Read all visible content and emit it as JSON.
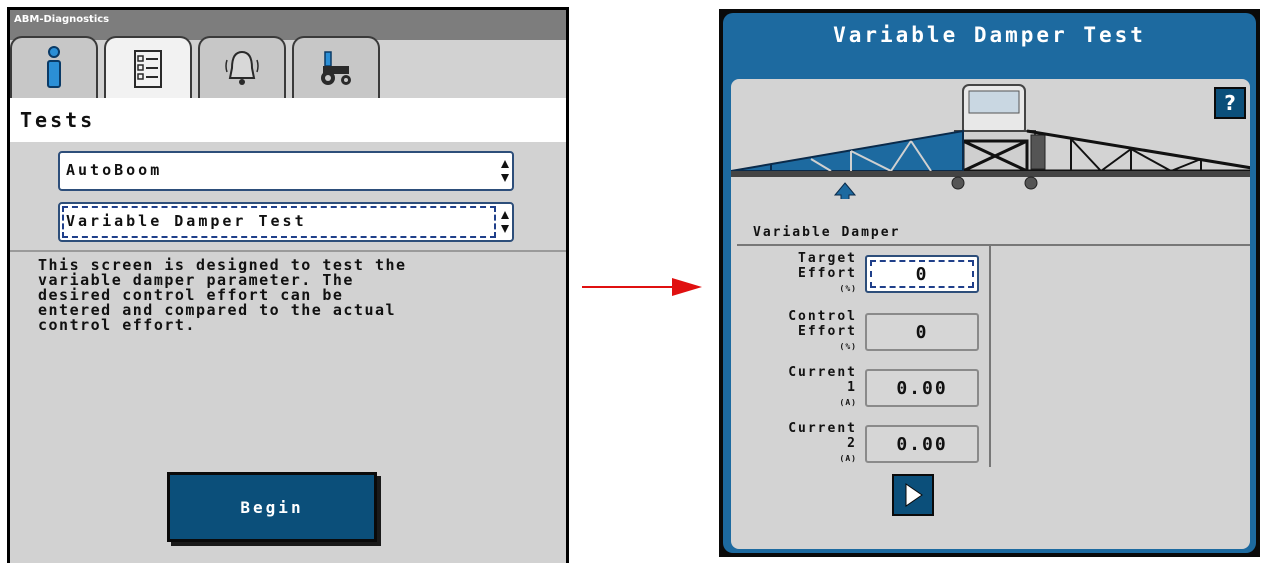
{
  "left": {
    "app_title": "ABM-Diagnostics",
    "tabs": [
      {
        "icon": "info-icon"
      },
      {
        "icon": "checklist-icon",
        "active": true
      },
      {
        "icon": "alarm-bell-icon"
      },
      {
        "icon": "tractor-icon"
      }
    ],
    "section_title": "Tests",
    "dropdown_system": {
      "value": "AutoBoom"
    },
    "dropdown_test": {
      "value": "Variable Damper Test"
    },
    "description": [
      "This screen is designed to test the",
      "variable damper parameter. The",
      "desired control effort can be",
      "entered and compared to the actual",
      "control effort."
    ],
    "begin_label": "Begin"
  },
  "right": {
    "title": "Variable Damper Test",
    "help_label": "?",
    "indicator_label": "Variable Damper",
    "fields": [
      {
        "label_lines": [
          "Target",
          "Effort"
        ],
        "unit": "(%)",
        "value": "0",
        "editable": true
      },
      {
        "label_lines": [
          "Control",
          "Effort"
        ],
        "unit": "(%)",
        "value": "0",
        "editable": false
      },
      {
        "label_lines": [
          "Current",
          "1"
        ],
        "unit": "(A)",
        "value": "0.00",
        "editable": false
      },
      {
        "label_lines": [
          "Current",
          "2"
        ],
        "unit": "(A)",
        "value": "0.00",
        "editable": false
      }
    ]
  },
  "colors": {
    "accent_blue": "#1d6aa0",
    "button_blue": "#0b4f7a",
    "arrow_red": "#e01010",
    "panel_gray": "#d2d2d2"
  }
}
